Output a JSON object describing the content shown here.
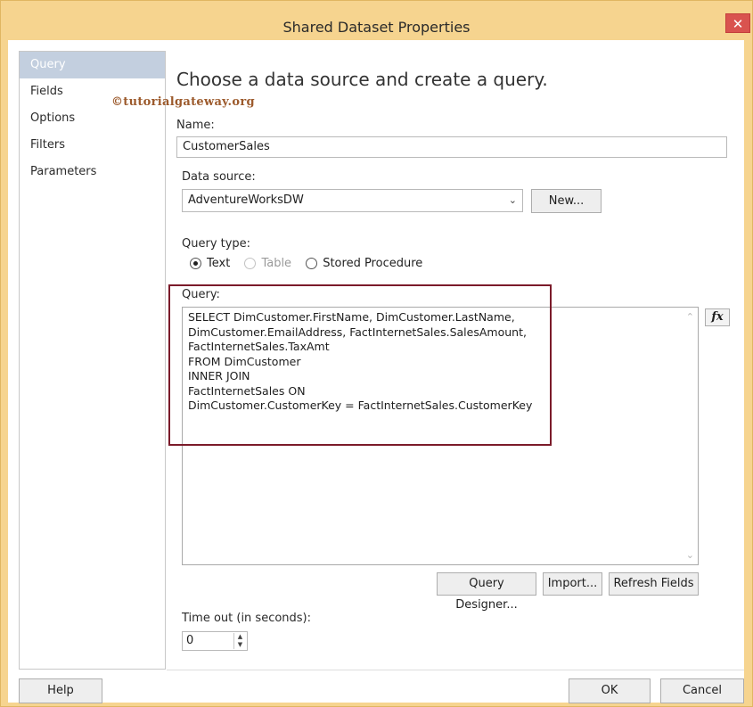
{
  "window": {
    "title": "Shared Dataset Properties",
    "close_glyph": "✕"
  },
  "sidebar": {
    "items": [
      {
        "label": "Query",
        "active": true
      },
      {
        "label": "Fields",
        "active": false
      },
      {
        "label": "Options",
        "active": false
      },
      {
        "label": "Filters",
        "active": false
      },
      {
        "label": "Parameters",
        "active": false
      }
    ]
  },
  "watermark": "©tutorialgateway.org",
  "main": {
    "heading": "Choose a data source and create a query.",
    "name_label": "Name:",
    "name_value": "CustomerSales",
    "datasource_label": "Data source:",
    "datasource_value": "AdventureWorksDW",
    "new_button": "New...",
    "query_type_label": "Query type:",
    "query_type_options": [
      {
        "label": "Text",
        "checked": true,
        "disabled": false
      },
      {
        "label": "Table",
        "checked": false,
        "disabled": true
      },
      {
        "label": "Stored Procedure",
        "checked": false,
        "disabled": false
      }
    ],
    "query_label": "Query:",
    "query_text": "SELECT DimCustomer.FirstName, DimCustomer.LastName,\nDimCustomer.EmailAddress, FactInternetSales.SalesAmount,\nFactInternetSales.TaxAmt\nFROM DimCustomer\nINNER JOIN\nFactInternetSales ON\nDimCustomer.CustomerKey = FactInternetSales.CustomerKey",
    "fx_button": "fx",
    "query_designer_button": "Query Designer...",
    "import_button": "Import...",
    "refresh_fields_button": "Refresh Fields",
    "timeout_label": "Time out (in seconds):",
    "timeout_value": "0"
  },
  "footer": {
    "help_button": "Help",
    "ok_button": "OK",
    "cancel_button": "Cancel"
  },
  "colors": {
    "title_bar": "#f6d48f",
    "active_sidebar": "#c3cfdf",
    "highlight_box": "#7b1b2a",
    "watermark": "#9c5a2c"
  }
}
